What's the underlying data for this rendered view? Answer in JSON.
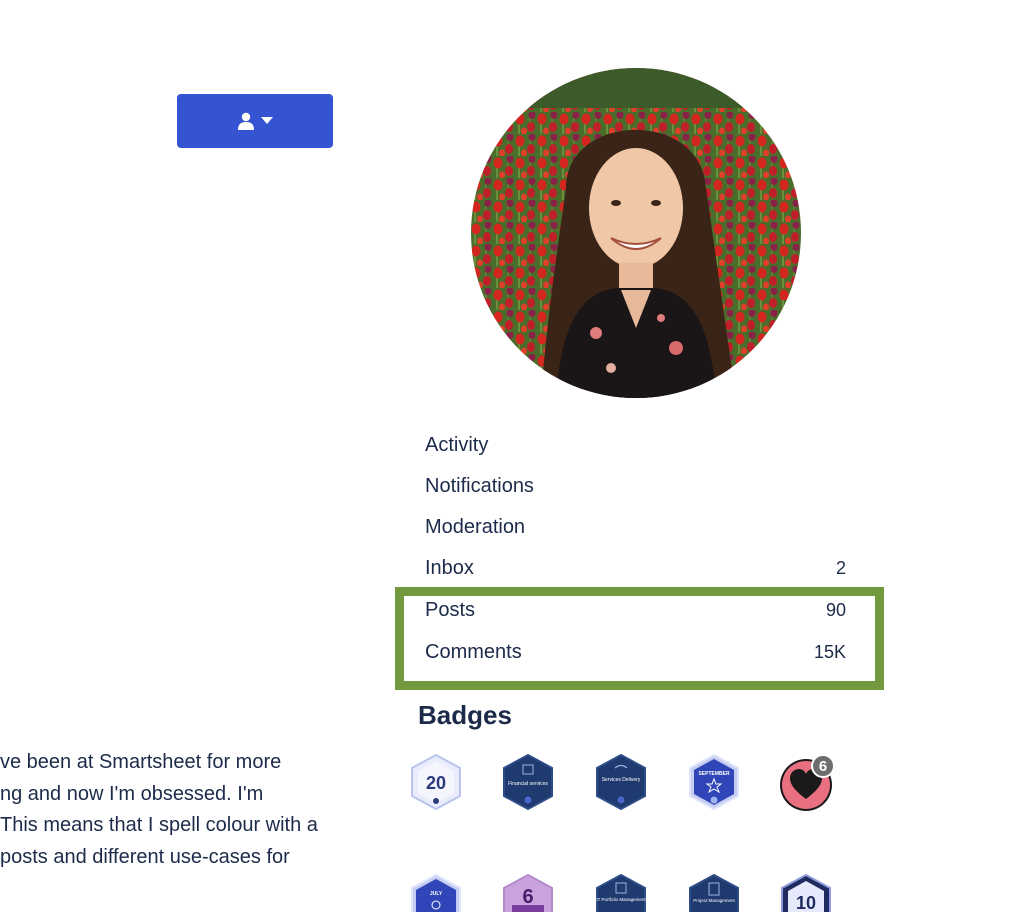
{
  "nav": {
    "items": [
      {
        "label": "Activity",
        "count": ""
      },
      {
        "label": "Notifications",
        "count": ""
      },
      {
        "label": "Moderation",
        "count": ""
      },
      {
        "label": "Inbox",
        "count": "2"
      },
      {
        "label": "Posts",
        "count": "90"
      },
      {
        "label": "Comments",
        "count": "15K"
      }
    ]
  },
  "badges": {
    "heading": "Badges",
    "row1": [
      {
        "name": "20-anniversary-badge",
        "text": "20"
      },
      {
        "name": "financial-services-badge",
        "text": "Financial services"
      },
      {
        "name": "services-delivery-badge",
        "text": "Services Delivery"
      },
      {
        "name": "september-badge",
        "text": "SEPTEMBER"
      },
      {
        "name": "heart-badge",
        "count": "6"
      }
    ],
    "row2": [
      {
        "name": "july-badge",
        "text": "JULY"
      },
      {
        "name": "six-badge",
        "text": "6"
      },
      {
        "name": "it-portfolio-management-badge",
        "text": "IT Portfolio Management"
      },
      {
        "name": "project-management-badge",
        "text": "Project Management"
      },
      {
        "name": "ten-badge",
        "text": "10"
      }
    ]
  },
  "about": {
    "lines": [
      "ve been at Smartsheet for more",
      "ng and now I'm obsessed. I'm",
      "This means that I spell colour with a",
      "posts and different use-cases for"
    ]
  },
  "colors": {
    "button": "#3454d1",
    "highlight": "#72993e",
    "text": "#1c2b4a",
    "badge_navy": "#1f3a6e"
  },
  "icons": {
    "user_menu": "user-icon",
    "user_menu_caret": "caret-down-icon"
  }
}
